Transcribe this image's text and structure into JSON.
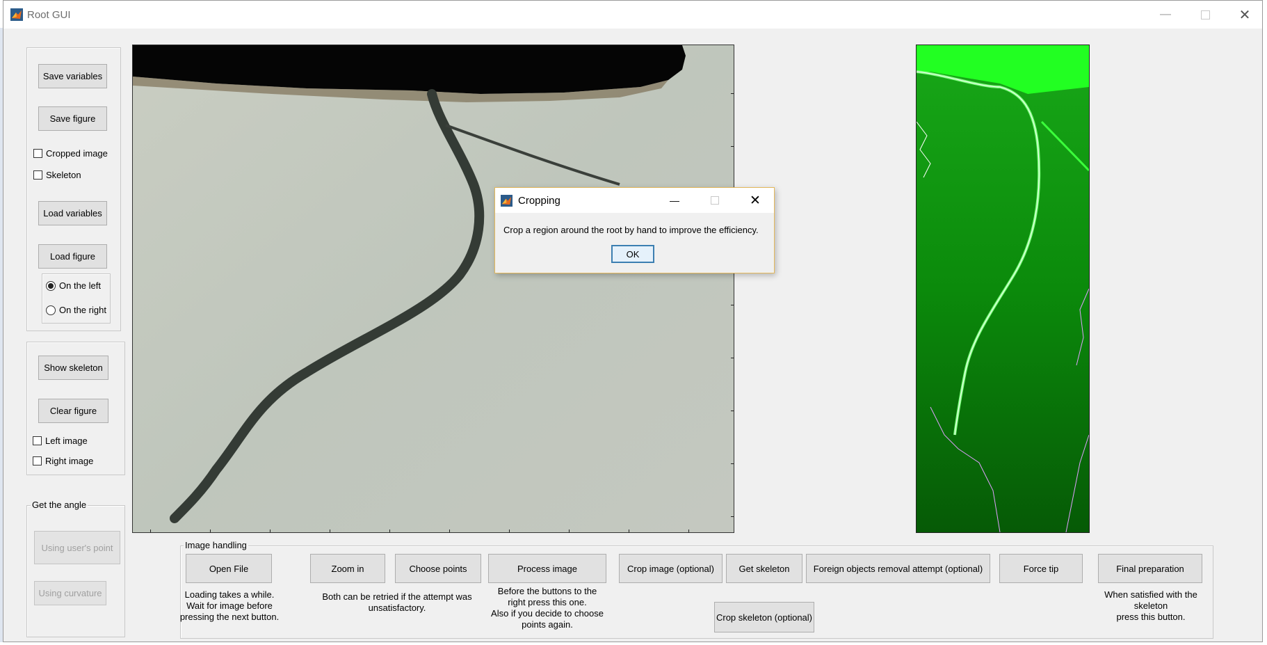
{
  "window": {
    "title": "Root GUI",
    "controls": [
      "minimize-icon",
      "maximize-icon",
      "close-icon"
    ]
  },
  "left_panel": {
    "save_variables": "Save variables",
    "save_figure": "Save figure",
    "cropped_image": "Cropped image",
    "skeleton": "Skeleton",
    "load_variables": "Load variables",
    "load_figure": "Load figure",
    "on_the_left": "On the left",
    "on_the_right": "On the right",
    "show_skeleton": "Show skeleton",
    "clear_figure": "Clear figure",
    "left_image": "Left image",
    "right_image": "Right image"
  },
  "angle_panel": {
    "title": "Get the angle",
    "using_users_point": "Using user's point",
    "using_curvature": "Using curvature"
  },
  "image_handling": {
    "title": "Image handling",
    "open_file": "Open File",
    "open_file_hint": [
      "Loading takes a while.",
      "Wait for  image before",
      "pressing the next button."
    ],
    "zoom_in": "Zoom in",
    "choose_points": "Choose points",
    "retry_hint": [
      "Both can be retried if the attempt was",
      "unsatisfactory."
    ],
    "process_image": "Process image",
    "process_hint": [
      "Before the buttons to the",
      "right press this one.",
      "Also if you decide to choose",
      "points again."
    ],
    "crop_image": "Crop image (optional)",
    "get_skeleton": "Get skeleton",
    "foreign_objects": "Foreign objects removal attempt (optional)",
    "force_tip": "Force tip",
    "final_preparation": "Final preparation",
    "final_hint": [
      "When satisfied with the",
      "skeleton",
      "press this button."
    ],
    "crop_skeleton": "Crop skeleton (optional)"
  },
  "dialog": {
    "title": "Cropping",
    "message": "Crop a region around the root by hand to improve the efficiency.",
    "ok": "OK"
  },
  "colors": {
    "window_bg": "#f0f0f0",
    "right_image_bg": "#0b8f0b",
    "dialog_border": "#e4b85a",
    "ok_border": "#3c7fb1"
  }
}
